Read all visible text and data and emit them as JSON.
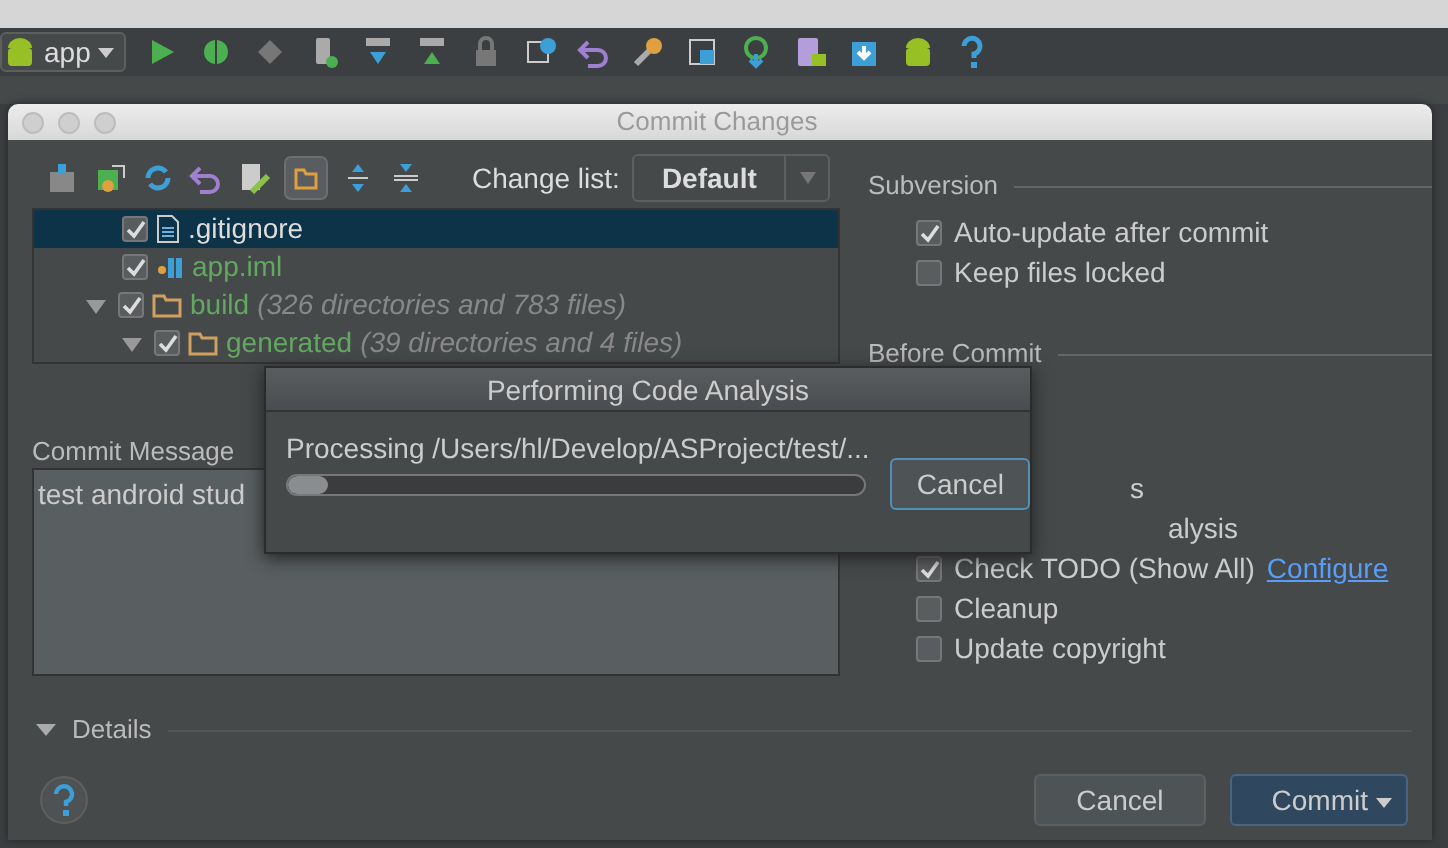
{
  "toolbar": {
    "run_config": "app"
  },
  "dialog": {
    "title": "Commit Changes",
    "change_list": {
      "label": "Change list:",
      "value": "Default"
    },
    "files": [
      {
        "name": ".gitignore",
        "kind": "file",
        "selected": true,
        "checked": true
      },
      {
        "name": "app.iml",
        "kind": "module",
        "selected": false,
        "checked": true
      },
      {
        "name": "build",
        "note": "(326 directories and 783 files)",
        "kind": "folder",
        "selected": false,
        "checked": true,
        "expanded": true,
        "children": [
          {
            "name": "generated",
            "note": "(39 directories and 4 files)",
            "kind": "folder",
            "selected": false,
            "checked": true,
            "expanded": true
          }
        ]
      }
    ],
    "commit_message": {
      "label": "Commit Message",
      "value": "test android stud"
    },
    "subversion": {
      "heading": "Subversion",
      "options": [
        {
          "label": "Auto-update after commit",
          "checked": true
        },
        {
          "label": "Keep files locked",
          "checked": false
        }
      ]
    },
    "before_commit": {
      "heading": "Before Commit",
      "options": [
        {
          "label": "s",
          "kind": "covered"
        },
        {
          "label": "alysis",
          "kind": "covered"
        },
        {
          "label": "Check TODO (Show All)",
          "link": "Configure",
          "checked": true,
          "kind": "checkbox"
        },
        {
          "label": "Cleanup",
          "checked": false,
          "kind": "checkbox"
        },
        {
          "label": "Update copyright",
          "checked": false,
          "kind": "checkbox"
        }
      ]
    },
    "details": {
      "label": "Details",
      "expanded": true
    },
    "buttons": [
      {
        "label": "Cancel",
        "kind": "default"
      },
      {
        "label": "Commit",
        "kind": "primary"
      }
    ]
  },
  "progress": {
    "title": "Performing Code Analysis",
    "message": "Processing /Users/hl/Develop/ASProject/test/...",
    "level": 0.07,
    "button": "Cancel"
  }
}
